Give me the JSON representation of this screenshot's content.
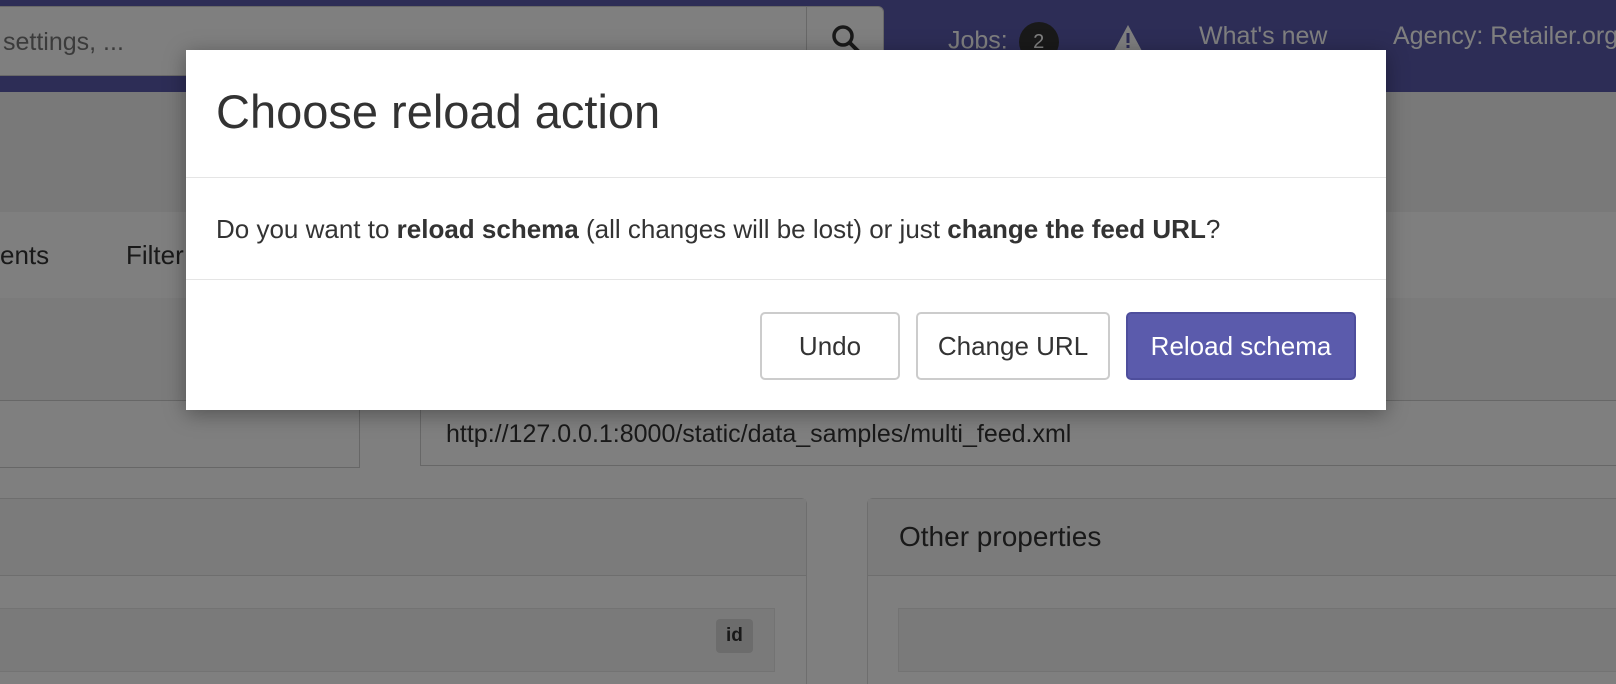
{
  "topbar": {
    "search_placeholder": "settings, ...",
    "jobs_label": "Jobs:",
    "jobs_count": "2",
    "whats_new": "What's new",
    "agency": "Agency: Retailer.org"
  },
  "tabs": {
    "tab1": "ents",
    "tab2": "Filter"
  },
  "form": {
    "feed_url": "http://127.0.0.1:8000/static/data_samples/multi_feed.xml"
  },
  "panels": {
    "right_title": "Other properties",
    "id_badge": "id"
  },
  "modal": {
    "title": "Choose reload action",
    "body_pre": "Do you want to ",
    "body_bold1": "reload schema",
    "body_mid": " (all changes will be lost) or just ",
    "body_bold2": "change the feed URL",
    "body_post": "?",
    "undo_label": "Undo",
    "change_url_label": "Change URL",
    "reload_label": "Reload schema"
  },
  "colors": {
    "brand": "#5b5bac",
    "backdrop": "rgba(0,0,0,0.5)"
  }
}
